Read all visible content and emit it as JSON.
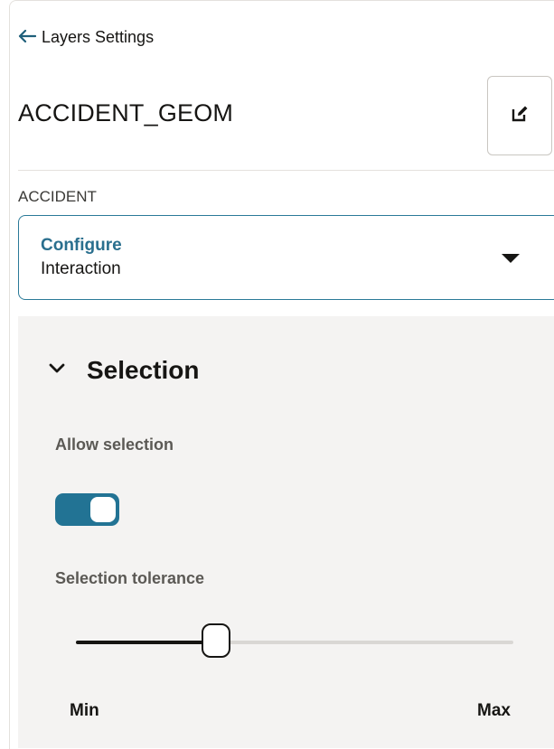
{
  "header": {
    "back_label": "Layers Settings",
    "layer_title": "ACCIDENT_GEOM"
  },
  "source": {
    "label": "ACCIDENT"
  },
  "dropdown": {
    "primary": "Configure",
    "selected": "Interaction"
  },
  "selection": {
    "title": "Selection",
    "allow_label": "Allow selection",
    "allow_enabled": true,
    "tolerance_label": "Selection tolerance",
    "tolerance_fraction": 0.32,
    "min_label": "Min",
    "max_label": "Max"
  },
  "colors": {
    "accent": "#227394",
    "dropdown_border": "#2a7a98",
    "panel_bg": "#f4f3f2"
  },
  "icons": {
    "back": "arrow-left-icon",
    "edit": "edit-icon",
    "caret": "caret-down-icon",
    "collapse": "chevron-down-icon"
  }
}
